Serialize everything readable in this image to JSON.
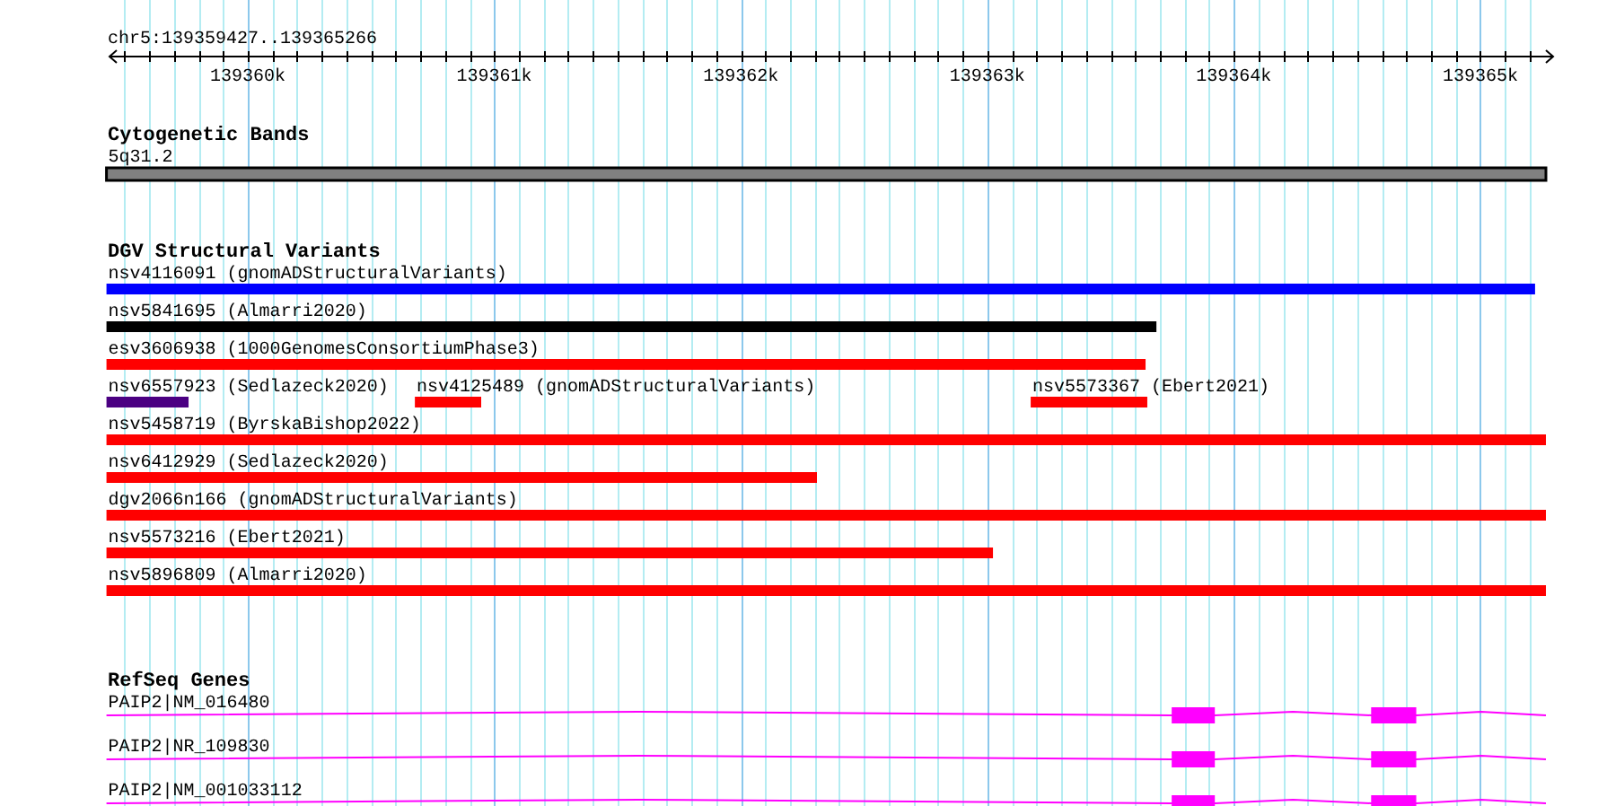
{
  "location": "chr5:139359427..139365266",
  "ruler": {
    "ticks": [
      "139360k",
      "139361k",
      "139362k",
      "139363k",
      "139364k",
      "139365k"
    ]
  },
  "tracks": [
    {
      "title": "Cytogenetic Bands",
      "kind": "bands",
      "rows": [
        [
          {
            "label": "5q31.2",
            "color": "#808080"
          }
        ]
      ]
    },
    {
      "title": "DGV Structural Variants",
      "kind": "variants",
      "rows": [
        [
          {
            "label": "nsv4116091 (gnomADStructuralVariants)",
            "color": "#0000ff"
          }
        ],
        [
          {
            "label": "nsv5841695 (Almarri2020)",
            "color": "#000000"
          }
        ],
        [
          {
            "label": "esv3606938 (1000GenomesConsortiumPhase3)",
            "color": "#ff0000"
          }
        ],
        [
          {
            "label": "nsv6557923 (Sedlazeck2020)",
            "color": "#4b0082"
          },
          {
            "label": "nsv4125489 (gnomADStructuralVariants)",
            "color": "#ff0000"
          },
          {
            "label": "nsv5573367 (Ebert2021)",
            "color": "#ff0000"
          }
        ],
        [
          {
            "label": "nsv5458719 (ByrskaBishop2022)",
            "color": "#ff0000"
          }
        ],
        [
          {
            "label": "nsv6412929 (Sedlazeck2020)",
            "color": "#ff0000"
          }
        ],
        [
          {
            "label": "dgv2066n166 (gnomADStructuralVariants)",
            "color": "#ff0000"
          }
        ],
        [
          {
            "label": "nsv5573216 (Ebert2021)",
            "color": "#ff0000"
          }
        ],
        [
          {
            "label": "nsv5896809 (Almarri2020)",
            "color": "#ff0000"
          }
        ]
      ]
    },
    {
      "title": "RefSeq Genes",
      "kind": "genes",
      "rows": [
        [
          {
            "label": "PAIP2|NM_016480",
            "color": "#ff00ff"
          }
        ],
        [
          {
            "label": "PAIP2|NR_109830",
            "color": "#ff00ff"
          }
        ],
        [
          {
            "label": "PAIP2|NM_001033112",
            "color": "#ff00ff"
          }
        ]
      ]
    }
  ]
}
